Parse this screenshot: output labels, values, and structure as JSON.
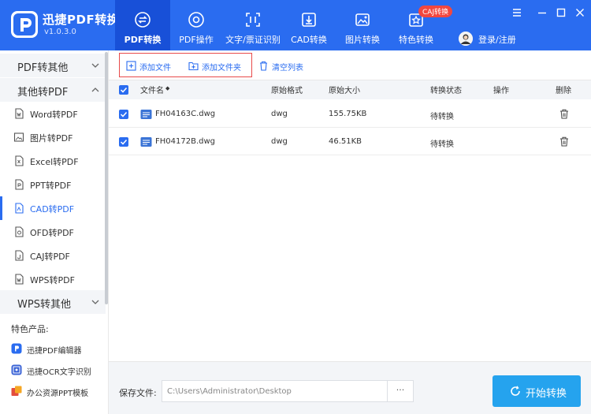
{
  "app": {
    "name": "迅捷PDF转换器",
    "version": "v1.0.3.0"
  },
  "nav": {
    "tabs": [
      {
        "label": "PDF转换",
        "icon": "convert-icon",
        "active": true
      },
      {
        "label": "PDF操作",
        "icon": "pdf-operate-icon"
      },
      {
        "label": "文字/票证识别",
        "icon": "ocr-scan-icon"
      },
      {
        "label": "CAD转换",
        "icon": "cad-convert-icon"
      },
      {
        "label": "图片转换",
        "icon": "image-convert-icon"
      },
      {
        "label": "特色转换",
        "icon": "feature-convert-icon"
      }
    ],
    "badge": "CAJ转换",
    "login": "登录/注册"
  },
  "sidebar": {
    "categories": [
      {
        "label": "PDF转其他",
        "expanded": false
      },
      {
        "label": "其他转PDF",
        "expanded": true
      },
      {
        "label": "WPS转其他",
        "expanded": false
      }
    ],
    "items": [
      {
        "label": "Word转PDF",
        "icon": "word-doc-icon"
      },
      {
        "label": "图片转PDF",
        "icon": "image-icon"
      },
      {
        "label": "Excel转PDF",
        "icon": "excel-doc-icon"
      },
      {
        "label": "PPT转PDF",
        "icon": "ppt-doc-icon"
      },
      {
        "label": "CAD转PDF",
        "icon": "cad-doc-icon",
        "active": true
      },
      {
        "label": "OFD转PDF",
        "icon": "ofd-doc-icon"
      },
      {
        "label": "CAJ转PDF",
        "icon": "caj-doc-icon"
      },
      {
        "label": "WPS转PDF",
        "icon": "wps-doc-icon"
      }
    ],
    "featured_title": "特色产品:",
    "featured": [
      {
        "label": "迅捷PDF编辑器",
        "icon": "pdf-editor-icon"
      },
      {
        "label": "迅捷OCR文字识别",
        "icon": "ocr-icon"
      },
      {
        "label": "办公资源PPT模板",
        "icon": "ppt-template-icon"
      }
    ]
  },
  "toolbar": {
    "add_file": "添加文件",
    "add_folder": "添加文件夹",
    "clear_list": "清空列表"
  },
  "table": {
    "headers": {
      "filename": "文件名",
      "sort_mark": "◆",
      "format": "原始格式",
      "size": "原始大小",
      "status": "转换状态",
      "action": "操作",
      "delete": "删除"
    },
    "rows": [
      {
        "filename": "FH04163C.dwg",
        "format": "dwg",
        "size": "155.75KB",
        "status": "待转换",
        "checked": true
      },
      {
        "filename": "FH04172B.dwg",
        "format": "dwg",
        "size": "46.51KB",
        "status": "待转换",
        "checked": true
      }
    ]
  },
  "footer": {
    "save_label": "保存文件:",
    "save_path": "C:\\Users\\Administrator\\Desktop",
    "browse": "···",
    "start": "开始转换"
  },
  "colors": {
    "header_bg": "#2a6cf0",
    "active_tab_bg": "#1850d8",
    "accent": "#2a6cf0",
    "start_button": "#25a3ee",
    "badge": "#f2473f",
    "highlight_box": "#e84a4a"
  }
}
